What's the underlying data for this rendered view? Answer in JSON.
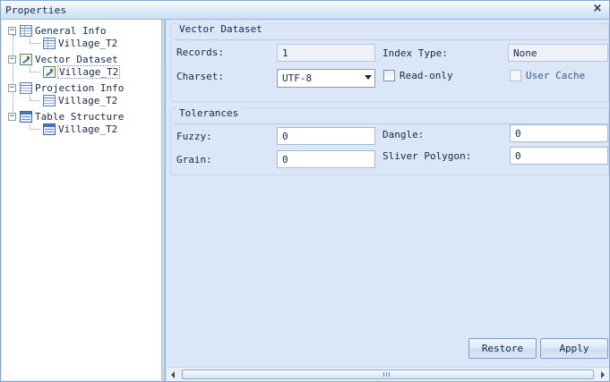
{
  "window": {
    "title": "Properties",
    "close_glyph": "×"
  },
  "tree": {
    "nodes": [
      {
        "label": "General Info",
        "icon": "table-icon",
        "expander": "−"
      },
      {
        "label": "Village_T2",
        "icon": "table-icon"
      },
      {
        "label": "Vector Dataset",
        "icon": "vector-dataset-icon",
        "expander": "−"
      },
      {
        "label": "Village_T2",
        "icon": "vector-dataset-icon",
        "selected": true
      },
      {
        "label": "Projection Info",
        "icon": "projection-icon",
        "expander": "−"
      },
      {
        "label": "Village_T2",
        "icon": "projection-icon"
      },
      {
        "label": "Table Structure",
        "icon": "table-structure-icon",
        "expander": "−"
      },
      {
        "label": "Village_T2",
        "icon": "table-structure-icon"
      }
    ]
  },
  "vector_dataset": {
    "title": "Vector Dataset",
    "records_label": "Records:",
    "records_value": "1",
    "index_type_label": "Index Type:",
    "index_type_value": "None",
    "charset_label": "Charset:",
    "charset_value": "UTF-8",
    "readonly_label": "Read-only",
    "readonly_checked": false,
    "user_cache_label": "User Cache",
    "user_cache_checked": false,
    "user_cache_enabled": false
  },
  "tolerances": {
    "title": "Tolerances",
    "fuzzy_label": "Fuzzy:",
    "fuzzy_value": "0",
    "dangle_label": "Dangle:",
    "dangle_value": "0",
    "grain_label": "Grain:",
    "grain_value": "0",
    "sliver_label": "Sliver Polygon:",
    "sliver_value": "0"
  },
  "buttons": {
    "restore": "Restore",
    "apply": "Apply"
  },
  "colors": {
    "window_bg": "#dbe7f6",
    "border": "#8aa6cc",
    "text": "#15284b"
  }
}
